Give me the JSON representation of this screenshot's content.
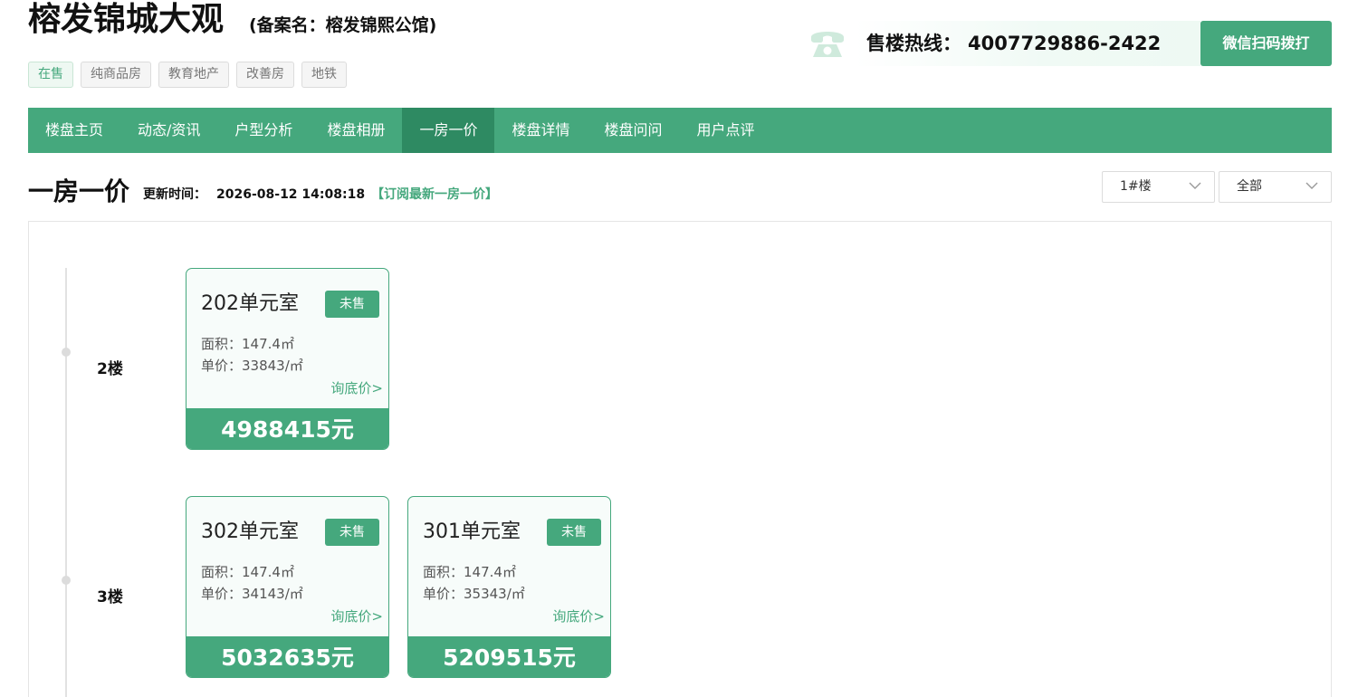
{
  "header": {
    "title": "榕发锦城大观",
    "subtitle": "(备案名：榕发锦熙公馆)",
    "tags": [
      "在售",
      "纯商品房",
      "教育地产",
      "改善房",
      "地铁"
    ],
    "hotline_label": "售楼热线：",
    "hotline_number": "4007729886-2422",
    "wechat_button": "微信扫码拨打",
    "phone_icon": "telephone-icon"
  },
  "nav": {
    "items": [
      "楼盘主页",
      "动态/资讯",
      "户型分析",
      "楼盘相册",
      "一房一价",
      "楼盘详情",
      "楼盘问问",
      "用户点评"
    ],
    "active_index": 4
  },
  "section": {
    "title": "一房一价",
    "update_label": "更新时间：",
    "update_time": "2026-08-12 14:08:18",
    "subscribe": "【订阅最新一房一价】"
  },
  "filters": {
    "building": "1#楼",
    "status": "全部"
  },
  "floors": [
    {
      "label": "2楼",
      "units": [
        {
          "room": "202单元室",
          "status": "未售",
          "area": "面积：147.4㎡",
          "unit_price": "单价：33843/㎡",
          "ask": "询底价>",
          "total": "4988415元"
        }
      ]
    },
    {
      "label": "3楼",
      "units": [
        {
          "room": "302单元室",
          "status": "未售",
          "area": "面积：147.4㎡",
          "unit_price": "单价：34143/㎡",
          "ask": "询底价>",
          "total": "5032635元"
        },
        {
          "room": "301单元室",
          "status": "未售",
          "area": "面积：147.4㎡",
          "unit_price": "单价：35343/㎡",
          "ask": "询底价>",
          "total": "5209515元"
        }
      ]
    }
  ],
  "colors": {
    "brand": "#45a87d",
    "brand_dark": "#2e8a62"
  }
}
